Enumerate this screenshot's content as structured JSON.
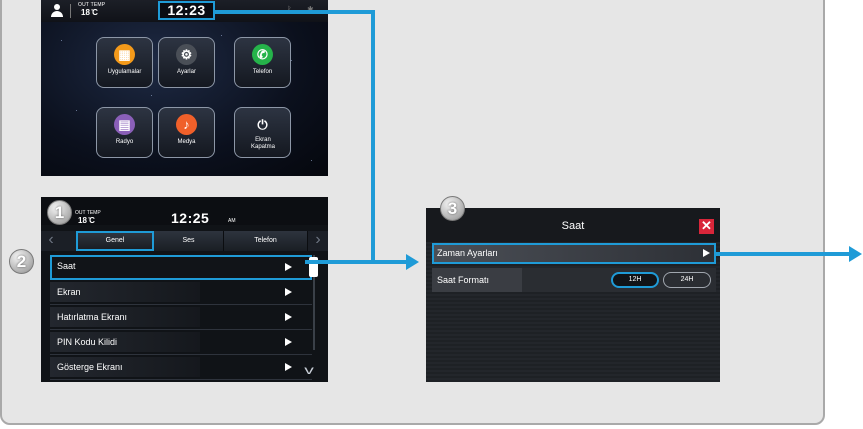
{
  "home": {
    "out_temp_label": "OUT TEMP",
    "out_temp": "18 ̊C",
    "clock": "12:23",
    "tiles": [
      {
        "label": "Uygulamalar",
        "icon": "apps-grid-icon",
        "color": "#f49a1a",
        "glyph": "▦"
      },
      {
        "label": "Ayarlar",
        "icon": "settings-gear-icon",
        "color": "#4a4f57",
        "glyph": "⚙"
      },
      {
        "label": "Telefon",
        "icon": "phone-icon",
        "color": "#25b34a",
        "glyph": "✆"
      },
      {
        "label": "Radyo",
        "icon": "radio-icon",
        "color": "#8a5fb8",
        "glyph": "▤"
      },
      {
        "label": "Medya",
        "icon": "music-note-icon",
        "color": "#f0602a",
        "glyph": "♪"
      },
      {
        "label": "Ekran Kapatma",
        "icon": "power-icon",
        "color": "transparent",
        "glyph": "⏻"
      }
    ]
  },
  "settings": {
    "out_temp_label": "OUT TEMP",
    "out_temp": "18 ̊C",
    "clock": "12:25",
    "ampm": "AM",
    "tabs": [
      "Genel",
      "Ses",
      "Telefon"
    ],
    "items": [
      "Saat",
      "Ekran",
      "Hatırlatma Ekranı",
      "PIN Kodu Kilidi",
      "Gösterge Ekranı"
    ]
  },
  "saat_dialog": {
    "title": "Saat",
    "zaman_label": "Zaman Ayarları",
    "format_label": "Saat Formatı",
    "format_12": "12H",
    "format_24": "24H"
  },
  "callouts": [
    "1",
    "2",
    "3"
  ],
  "colors": {
    "accent": "#1f9bd7",
    "close": "#d9263a"
  }
}
